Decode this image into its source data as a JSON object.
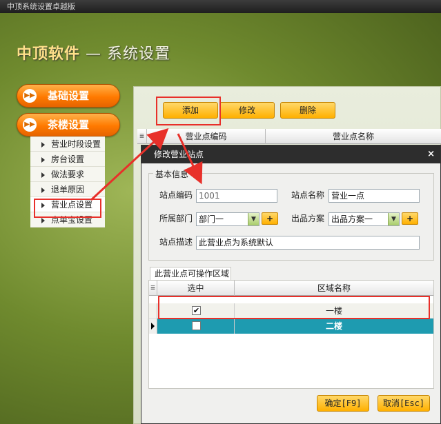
{
  "window": {
    "title": "中顶系统设置卓越版"
  },
  "header": {
    "brand": "中顶软件",
    "separator": "—",
    "section": "系统设置"
  },
  "left_menu": {
    "groups": [
      {
        "label": "基础设置"
      },
      {
        "label": "茶楼设置"
      }
    ],
    "items": [
      {
        "label": "营业时段设置"
      },
      {
        "label": "房台设置"
      },
      {
        "label": "做法要求"
      },
      {
        "label": "退单原因"
      },
      {
        "label": "营业点设置"
      },
      {
        "label": "点单宝设置"
      }
    ]
  },
  "toolbar": {
    "add": "添加",
    "edit": "修改",
    "delete": "删除"
  },
  "main_grid": {
    "columns": [
      "营业点编码",
      "营业点名称"
    ]
  },
  "dialog": {
    "title": "修改营业站点",
    "close": "×",
    "basic_info_legend": "基本信息",
    "station_code_label": "站点编码",
    "station_code_value": "1001",
    "station_name_label": "站点名称",
    "station_name_value": "营业一点",
    "department_label": "所属部门",
    "department_value": "部门一",
    "plan_label": "出品方案",
    "plan_value": "出品方案一",
    "plus": "+",
    "desc_label": "站点描述",
    "desc_value": "此营业点为系统默认",
    "area_tab": "此营业点可操作区域",
    "area_columns": [
      "选中",
      "区域名称"
    ],
    "areas": [
      {
        "name": "一楼",
        "checked": true
      },
      {
        "name": "二楼",
        "checked": false
      }
    ],
    "ok_button": "确定[F9]",
    "cancel_button": "取消[Esc]"
  },
  "colors": {
    "accent_orange": "#ff8a00",
    "button_yellow": "#ffc21f",
    "selected_row": "#1e9bb0",
    "highlight_red": "#e8302a"
  }
}
